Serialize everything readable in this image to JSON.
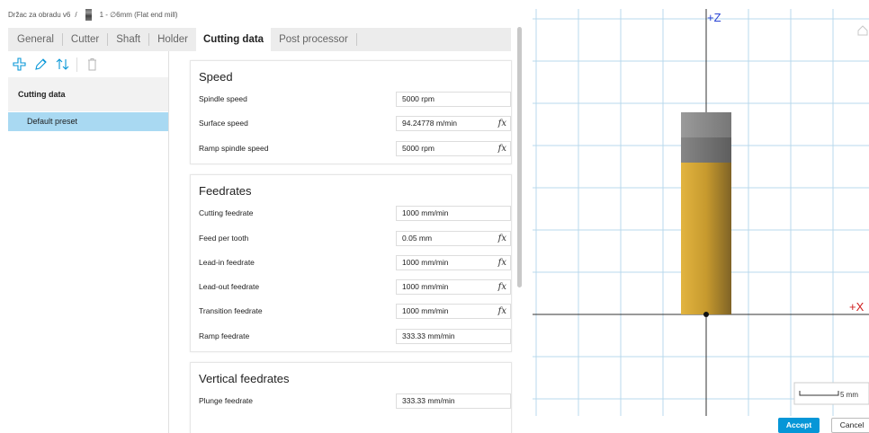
{
  "breadcrumb": {
    "parent": "Držac za obradu v6",
    "separator": "/",
    "tool": "1 - ∅6mm (Flat end mill)"
  },
  "tabs": [
    {
      "label": "General"
    },
    {
      "label": "Cutter"
    },
    {
      "label": "Shaft"
    },
    {
      "label": "Holder"
    },
    {
      "label": "Cutting data"
    },
    {
      "label": "Post processor"
    }
  ],
  "sidebar": {
    "header": "Cutting data",
    "items": [
      {
        "label": "Default preset"
      }
    ]
  },
  "speed": {
    "title": "Speed",
    "rows": [
      {
        "label": "Spindle speed",
        "value": "5000 rpm"
      },
      {
        "label": "Surface speed",
        "value": "94.24778 m/min",
        "fx": "fx"
      },
      {
        "label": "Ramp spindle speed",
        "value": "5000 rpm",
        "fx": "fx"
      }
    ]
  },
  "feedrates": {
    "title": "Feedrates",
    "rows": [
      {
        "label": "Cutting feedrate",
        "value": "1000 mm/min"
      },
      {
        "label": "Feed per tooth",
        "value": "0.05 mm",
        "fx": "fx"
      },
      {
        "label": "Lead-in feedrate",
        "value": "1000 mm/min",
        "fx": "fx"
      },
      {
        "label": "Lead-out feedrate",
        "value": "1000 mm/min",
        "fx": "fx"
      },
      {
        "label": "Transition feedrate",
        "value": "1000 mm/min",
        "fx": "fx"
      },
      {
        "label": "Ramp feedrate",
        "value": "333.33 mm/min"
      }
    ]
  },
  "vertical": {
    "title": "Vertical feedrates",
    "rows": [
      {
        "label": "Plunge feedrate",
        "value": "333.33 mm/min"
      }
    ]
  },
  "viewport": {
    "z_axis": "+Z",
    "x_axis": "+X",
    "scale": "5 mm"
  },
  "buttons": {
    "accept": "Accept",
    "cancel": "Cancel"
  },
  "colors": {
    "accent": "#0696d7",
    "selected": "#a9d9f2",
    "tool_body": "#d4a838",
    "holder": "#808080"
  }
}
